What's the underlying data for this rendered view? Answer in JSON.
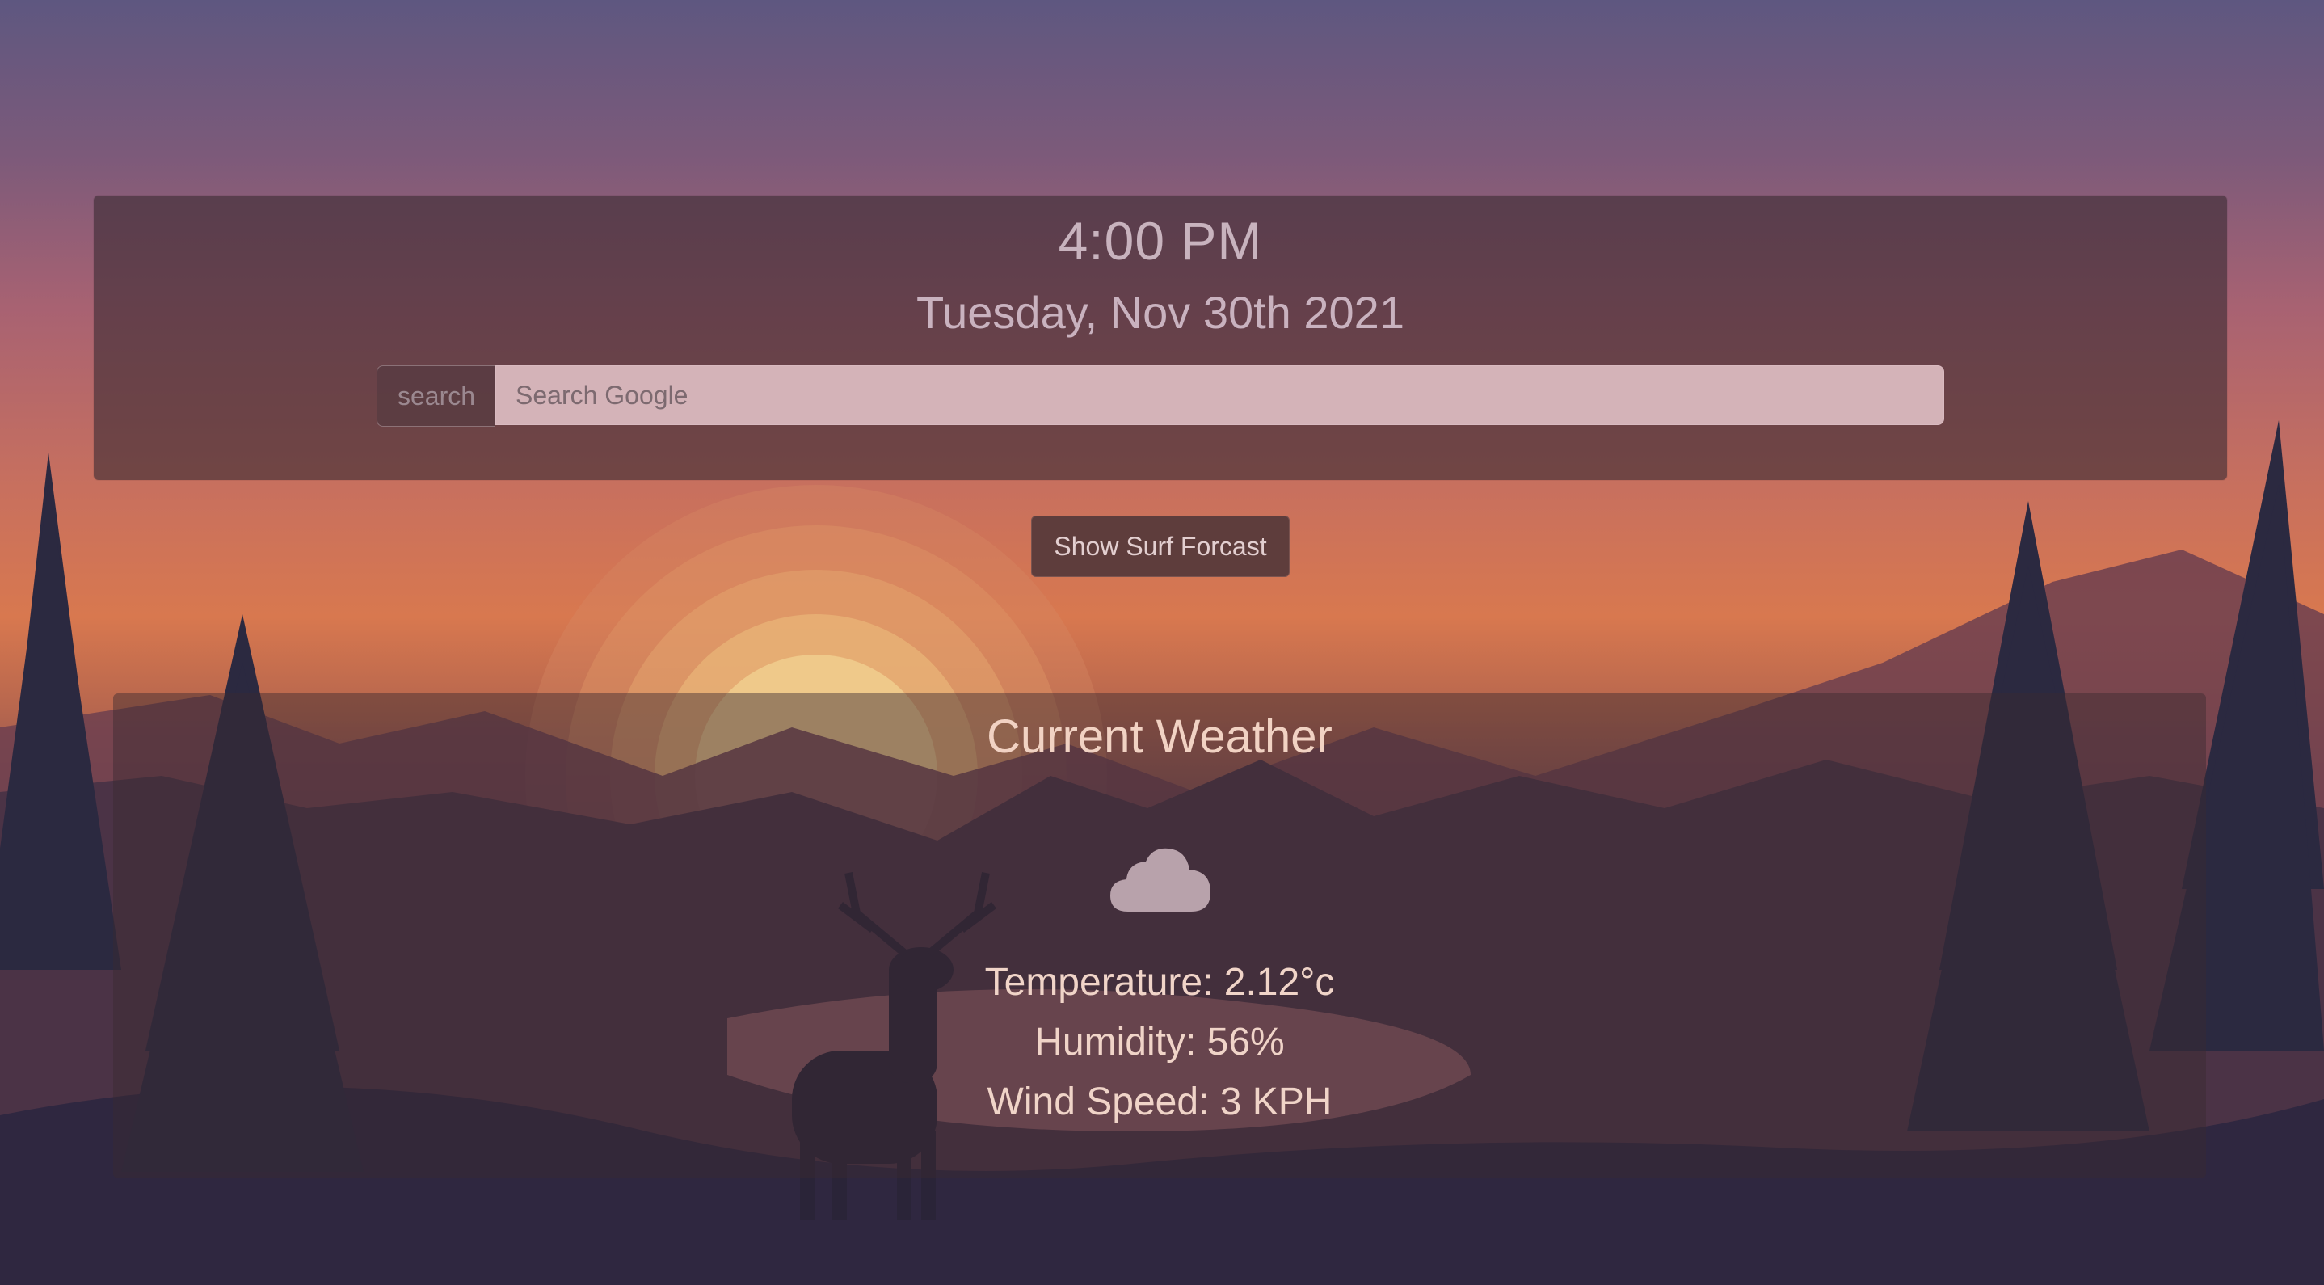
{
  "clock": {
    "time": "4:00 PM",
    "date": "Tuesday, Nov 30th 2021"
  },
  "search": {
    "label": "search",
    "placeholder": "Search Google"
  },
  "surf_button": {
    "label": "Show Surf Forcast"
  },
  "weather": {
    "title": "Current Weather",
    "icon": "cloud-icon",
    "temperature": "Temperature: 2.12°c",
    "humidity": "Humidity: 56%",
    "wind": "Wind Speed: 3 KPH"
  },
  "colors": {
    "panel": "#3c2c34",
    "input_bg": "#d4b3b8",
    "button_bg": "#5e3d3c",
    "accent_text": "#f1d2c3"
  }
}
